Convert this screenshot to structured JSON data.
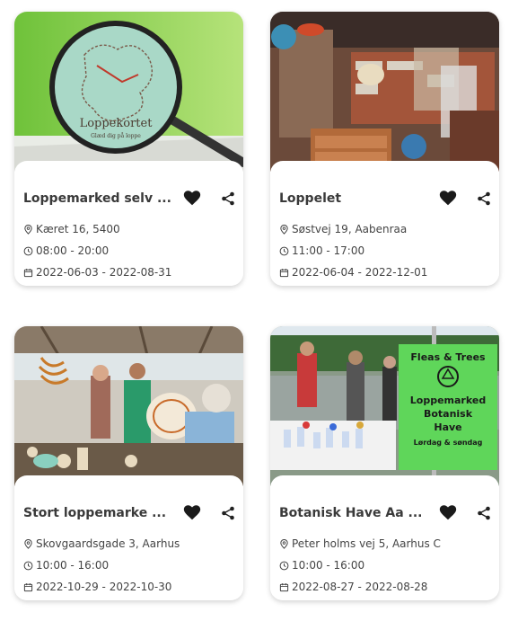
{
  "cards": [
    {
      "title": "Loppemarked selv ...",
      "address": "Kæret 16, 5400",
      "hours": "08:00 - 20:00",
      "dates": "2022-06-03 - 2022-08-31",
      "image_text": "Loppekortet",
      "image_subtext": "Glæd dig på loppe"
    },
    {
      "title": "Loppelet",
      "address": "Søstvej 19, Aabenraa",
      "hours": "11:00 - 17:00",
      "dates": "2022-06-04 - 2022-12-01"
    },
    {
      "title": "Stort loppemarke ...",
      "address": "Skovgaardsgade 3, Aarhus",
      "hours": "10:00 - 16:00",
      "dates": "2022-10-29 - 2022-10-30"
    },
    {
      "title": "Botanisk Have Aa ...",
      "address": "Peter holms vej 5, Aarhus C",
      "hours": "10:00 - 16:00",
      "dates": "2022-08-27 - 2022-08-28",
      "sign_line1": "Fleas & Trees",
      "sign_line2": "Loppemarked",
      "sign_line3": "Botanisk",
      "sign_line4": "Have",
      "sign_line5": "Lørdag & søndag"
    }
  ],
  "colors": {
    "heart": "#1a1a1a",
    "text": "#3a3a3a",
    "sign": "#5fd65a"
  },
  "icons": [
    "heart-icon",
    "share-icon",
    "location-pin-icon",
    "clock-icon",
    "calendar-icon"
  ]
}
